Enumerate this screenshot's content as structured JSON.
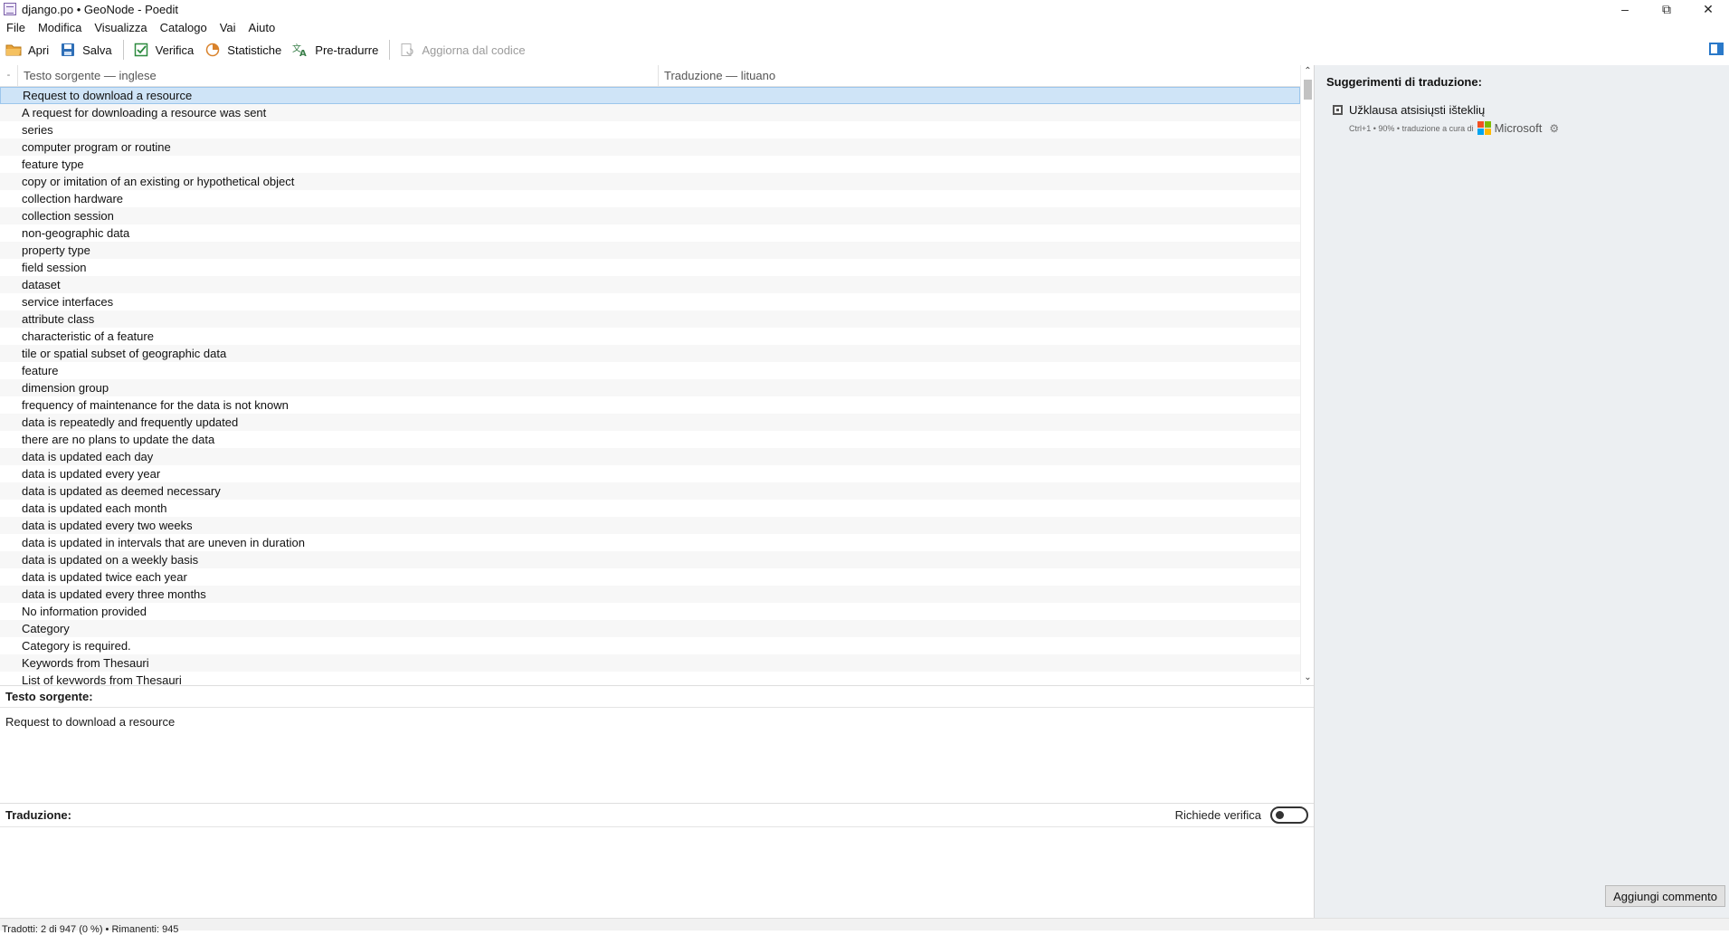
{
  "window": {
    "title": "django.po • GeoNode - Poedit"
  },
  "menu": [
    "File",
    "Modifica",
    "Visualizza",
    "Catalogo",
    "Vai",
    "Aiuto"
  ],
  "toolbar": {
    "open": "Apri",
    "save": "Salva",
    "validate": "Verifica",
    "stats": "Statistiche",
    "pretranslate": "Pre-tradurre",
    "update_from_code": "Aggiorna dal codice"
  },
  "list": {
    "sort_indicator": "-",
    "source_header": "Testo sorgente — inglese",
    "translation_header": "Traduzione — lituano",
    "rows": [
      "Request to download a resource",
      "A request for downloading a resource was sent",
      "series",
      "computer program or routine",
      "feature type",
      "copy or imitation of an existing or hypothetical object",
      "collection hardware",
      "collection session",
      "non-geographic data",
      "property type",
      "field session",
      "dataset",
      "service interfaces",
      "attribute class",
      "characteristic of a feature",
      "tile or spatial subset of geographic data",
      "feature",
      "dimension group",
      "frequency of maintenance for the data is not known",
      "data is repeatedly and frequently updated",
      "there are no plans to update the data",
      "data is updated each day",
      "data is updated every year",
      "data is updated as deemed necessary",
      "data is updated each month",
      "data is updated every two weeks",
      "data is updated in intervals that are uneven in duration",
      "data is updated on a weekly basis",
      "data is updated twice each year",
      "data is updated every three months",
      "No information provided",
      "Category",
      "Category is required.",
      "Keywords from Thesauri",
      "List of keywords from Thesauri"
    ]
  },
  "source_pane": {
    "title": "Testo sorgente:",
    "text": "Request to download a resource"
  },
  "translation_pane": {
    "title": "Traduzione:",
    "needs_review_label": "Richiede verifica",
    "value": ""
  },
  "sidebar": {
    "title": "Suggerimenti di traduzione:",
    "suggestion_text": "Užklausa atsisiųsti išteklių",
    "suggestion_meta": "Ctrl+1 • 90% • traduzione a cura di",
    "provider": "Microsoft",
    "add_comment": "Aggiungi commento"
  },
  "status": {
    "text": "Tradotti: 2 di 947 (0 %) • Rimanenti: 945"
  },
  "colors": {
    "selected_row": "#cfe4f7",
    "sidebar_bg": "#eceff2",
    "accent": "#2a79c9"
  }
}
